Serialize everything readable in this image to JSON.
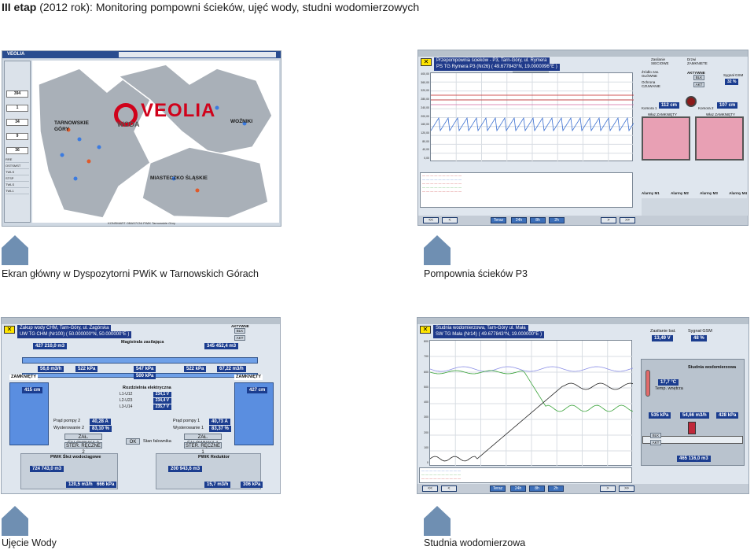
{
  "heading": {
    "bold": "III etap",
    "rest": " (2012 rok): Monitoring pompowni ścieków, ujęć wody, studni wodomierzowych"
  },
  "colors": {
    "tab": "#6f8fb2",
    "scada_title": "#1f3a8a",
    "plot_grid": "#d8dde3"
  },
  "captions": {
    "main": "Ekran główny w Dyspozytorni PWiK w Tarnowskich Górach",
    "p3": "Pompownia ścieków P3",
    "ujecie": "Ujęcie Wody",
    "studnia": "Studnia wodomierzowa"
  },
  "main_screen": {
    "logo_name": "VEOLIA",
    "logo_sub": "WODA",
    "header_logo": "VEOLIA",
    "regions": [
      "TARNOWSKIE GÓRY",
      "WOŹNIKI",
      "MIASTECZKO ŚLĄSKIE"
    ],
    "side_values": [
      "394",
      "1",
      "34",
      "9",
      "36"
    ],
    "side_list": [
      "RRE",
      "OSTSMST",
      "TWLS",
      "STSP",
      "TWLS",
      "TWL1"
    ],
    "footer": "KONSMART OBAS7CNI PWiK Tarnowskie Góry"
  },
  "p3": {
    "title1": "Przepompownia ścieków - P3, Tarn-Góry, ul. Rymera",
    "title2": "PS TG Rymera P3 (Nr26) ( 49.677843°N, 19.0000096°E )",
    "toggle": "Auto Odświeżanie",
    "status": [
      "Zasilanie SIECIOWE",
      "Drzwi ZAMKNIETE"
    ],
    "modes": [
      "Źródło zas. GŁÓWNE",
      "Ochrona CZUWANIE"
    ],
    "alarm": "AKTYWNE",
    "blk": "BLK",
    "akt": "AKT",
    "gsm_label": "Sygnał GSM",
    "gsm": "32 %",
    "chamber1": "Komora 1",
    "chamber2": "Komora 2",
    "level1": "112 cm",
    "level2": "107 cm",
    "lid1": "Właz ZAMKNIĘTY",
    "lid2": "Właz ZAMKNIĘTY",
    "alarms": [
      "Alarmy M1",
      "Alarmy M2",
      "Alarmy M3",
      "Alarmy M4"
    ],
    "yticks": [
      "400,00",
      "360,00",
      "320,00",
      "280,00",
      "240,00",
      "200,00",
      "160,00",
      "120,00",
      "80,00",
      "40,00",
      "0,00"
    ],
    "nav": [
      "<<",
      "<",
      "Teraz",
      "24h",
      "8h",
      "2h",
      ">",
      ">>"
    ]
  },
  "ujecie": {
    "title1": "Zakup wody CHM, Tarn-Góry, ul. Zagórska",
    "title2": "UW TG CHM (Nr100) ( 50.000000°N, 50.000000°E )",
    "totals": [
      "427 210,0 m3",
      "345 452,4 m3"
    ],
    "magistrala": "Magistrala zasilająca",
    "flows": [
      "56,6 m3/h",
      "522 kPa",
      "547 kPa",
      "522 kPa",
      "67,22 m3/h",
      "500 kPa"
    ],
    "lid_left": "ZAMKNIĘTY",
    "lid_right": "ZAMKNIĘTY",
    "level_left": "415 cm",
    "level_right": "427 cm",
    "rozdzielnia": "Rozdzielnia elektryczna",
    "phases": [
      {
        "l": "L1-U12",
        "v": "234,1 V"
      },
      {
        "l": "L2-U23",
        "v": "234,4 V"
      },
      {
        "l": "L3-U14",
        "v": "235,7 V"
      }
    ],
    "pump2": "Prąd pompy 2",
    "pump2_val": "40,28 A",
    "wys2": "Wysterowanie 2",
    "wys2_val": "83,10 %",
    "pump1": "Prąd pompy 1",
    "pump1_val": "40,73 A",
    "wys1": "Wysterowanie 1",
    "wys1_val": "83,37 %",
    "falownik2": "ZAŁ. FALOWNIKA 2",
    "falownik1": "ZAŁ. FALOWNIKA 1",
    "ster2": "STER. RĘCZNE 2",
    "ster1": "STER. RĘCZNE 1",
    "ok": "OK",
    "stan": "Stan falownika",
    "bottom_left": "PWiK Śleż wodociągowe",
    "bottom_right": "PWiK Reduktor",
    "bl_total": "724 743,0 m3",
    "br_total": "200 943,6 m3",
    "bl_flow": "120,5 m3/h",
    "bl_p": "666 kPa",
    "br_flow": "15,7 m3/h",
    "br_p": "306 kPa",
    "alarm": "AKTYWNE",
    "blk": "BLK",
    "akt": "AKT"
  },
  "studnia": {
    "title1": "Studnia wodomierzowa, Tarn-Góry ul. Mała",
    "title2": "SW TG Mała (Nr14) ( 49.677843°N, 19.000000°E )",
    "zasilanie": "Zasilanie bat.",
    "bat": "13,49 V",
    "gsm_label": "Sygnał GSM",
    "gsm": "48 %",
    "box": "Studnia wodomierzowa",
    "temp": "17,7 °C",
    "temp_label": "Temp. wnętrza",
    "p1": "535 kPa",
    "flow": "54,66 m3/h",
    "p2": "428 kPa",
    "total": "465 116,0 m3",
    "blk": "BLK",
    "akt": "AKT",
    "yticks": [
      "800",
      "700",
      "600",
      "500",
      "400",
      "300",
      "200",
      "100",
      "0"
    ],
    "nav": [
      "<<",
      "<",
      "Teraz",
      "24h",
      "8h",
      "2h",
      ">",
      ">>"
    ]
  }
}
